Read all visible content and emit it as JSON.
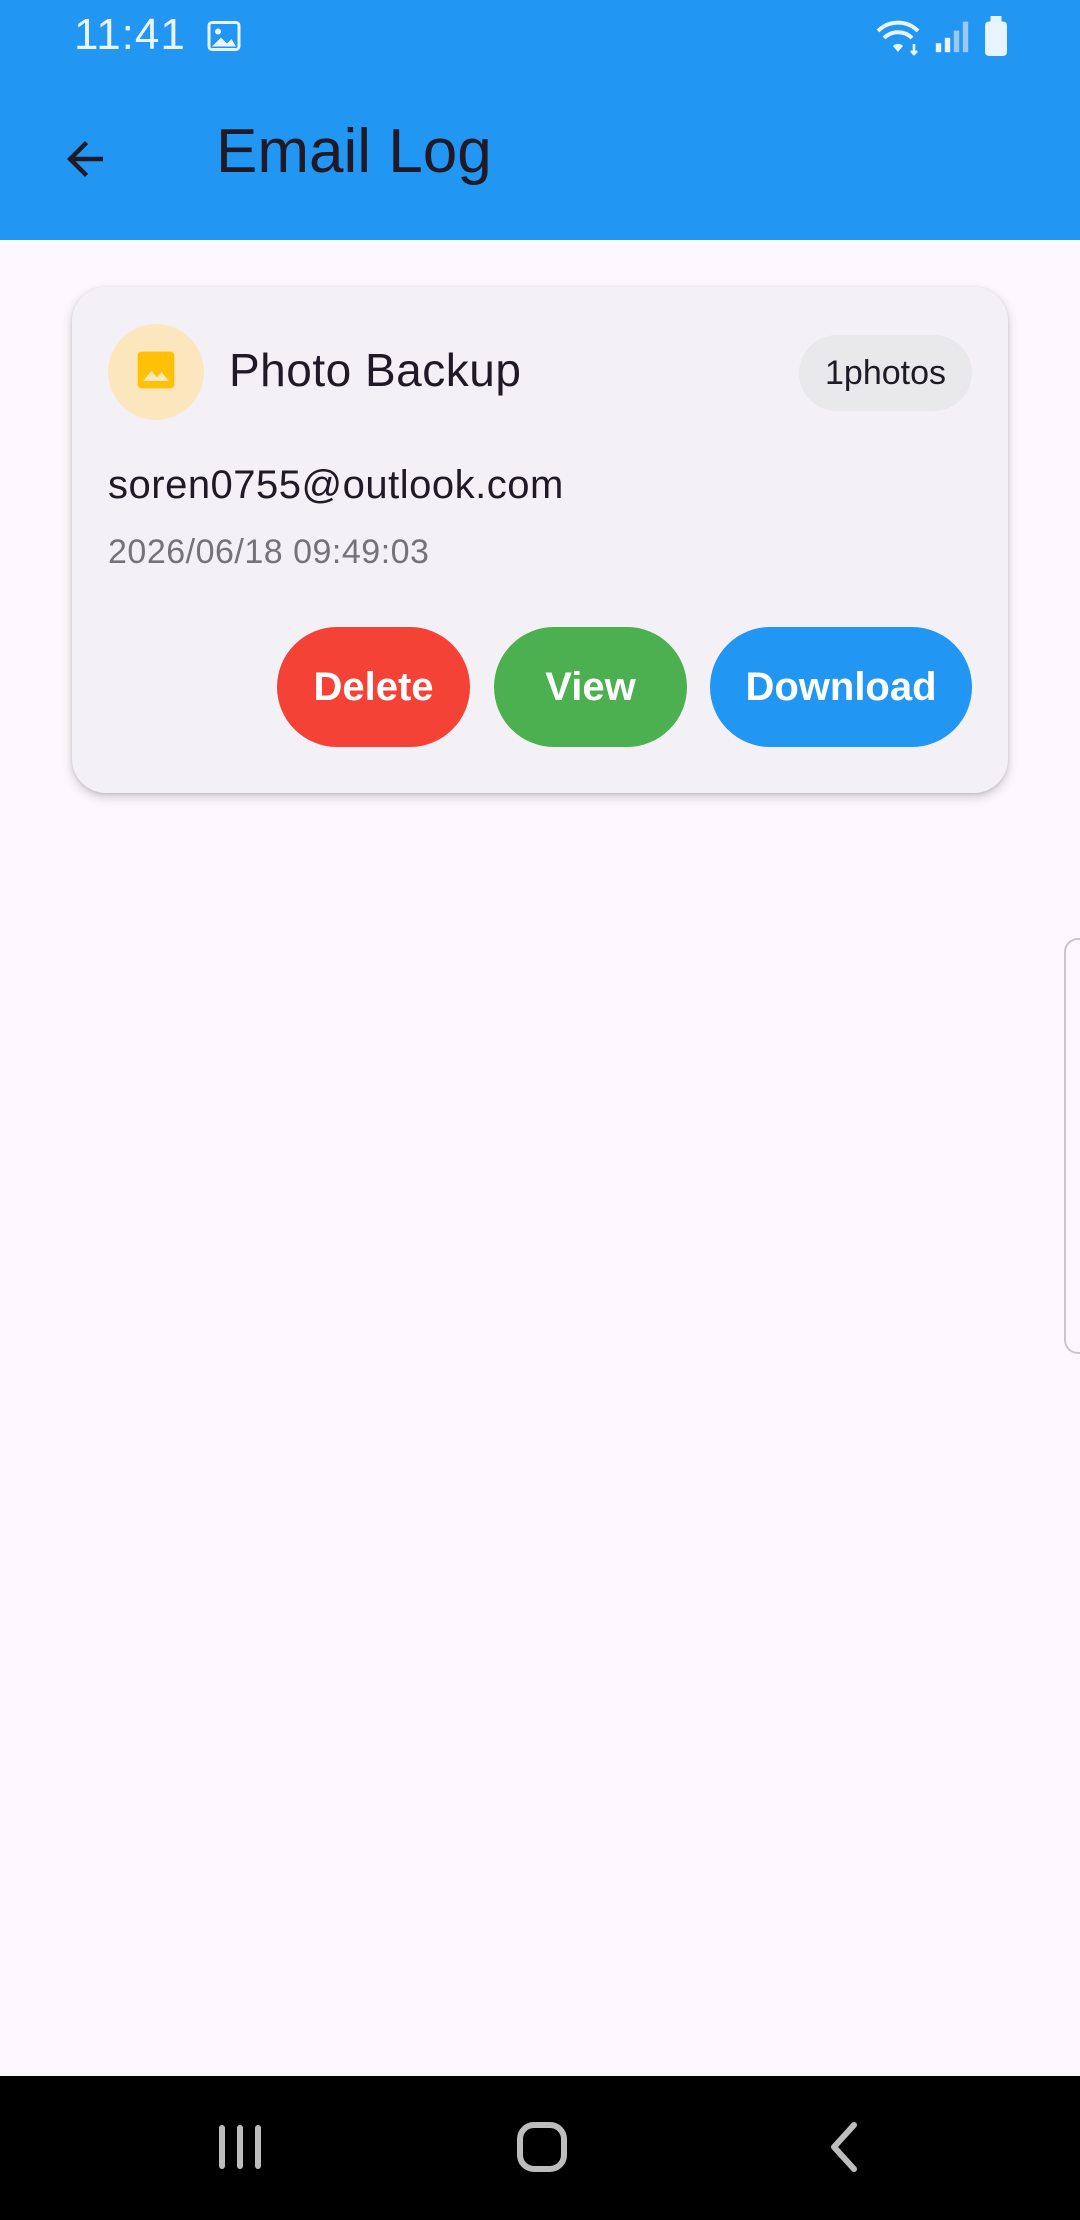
{
  "status_bar": {
    "time": "11:41",
    "icons": [
      "image-icon",
      "wifi-icon",
      "signal-icon",
      "battery-icon"
    ]
  },
  "app_bar": {
    "title": "Email Log",
    "back_icon": "arrow-back-icon"
  },
  "log_card": {
    "title": "Photo Backup",
    "count_badge": "1photos",
    "email": "soren0755@outlook.com",
    "timestamp": "2026/06/18 09:49:03",
    "icon": "photo-icon",
    "buttons": {
      "delete": "Delete",
      "view": "View",
      "download": "Download"
    }
  },
  "navigation_bar": {
    "icons": [
      "recents-icon",
      "home-icon",
      "back-icon"
    ]
  },
  "colors": {
    "primary": "#2196F3",
    "delete": "#F44336",
    "view": "#4CAF50",
    "download": "#2196F3",
    "avatar_bg": "#FBE6BE",
    "avatar_icon": "#FFC107"
  }
}
